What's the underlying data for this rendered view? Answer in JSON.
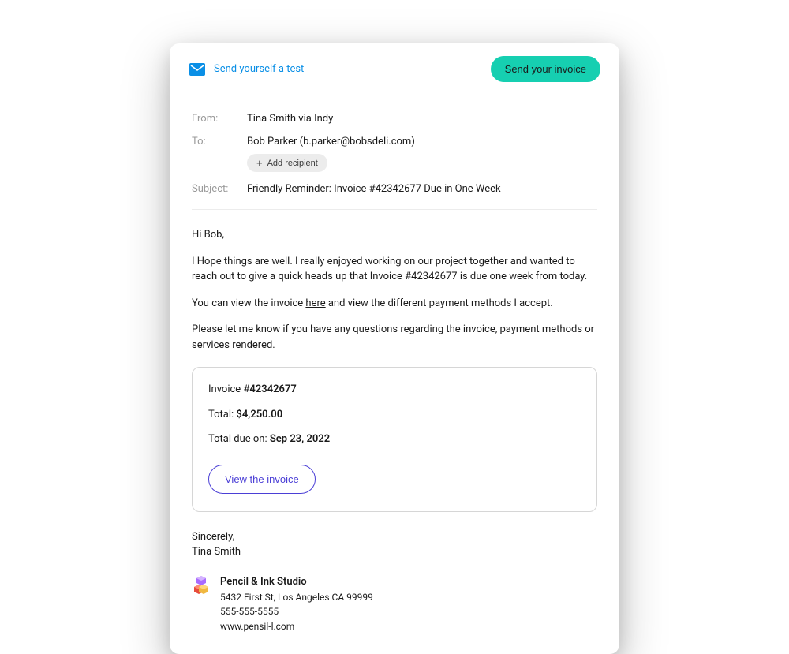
{
  "header": {
    "test_link": "Send yourself a test",
    "send_button": "Send your invoice"
  },
  "fields": {
    "from_label": "From:",
    "from_value": "Tina Smith via Indy",
    "to_label": "To:",
    "to_value": "Bob Parker (b.parker@bobsdeli.com)",
    "add_recipient": "Add recipient",
    "subject_label": "Subject:",
    "subject_value": "Friendly Reminder: Invoice #42342677 Due in One Week"
  },
  "body": {
    "greeting": "Hi Bob,",
    "para1": "I Hope things are well. I really enjoyed working on our project together and wanted to reach out to give a quick heads up that Invoice #42342677 is due one week from today.",
    "para2_before": "You can view the invoice ",
    "para2_link": "here",
    "para2_after": " and view the different payment methods I accept.",
    "para3": "Please let me know if you have any questions regarding the invoice, payment methods or services rendered."
  },
  "invoice": {
    "number_label": "Invoice #",
    "number": "42342677",
    "total_label": "Total: ",
    "total": "$4,250.00",
    "due_label": "Total due on: ",
    "due_date": "Sep 23, 2022",
    "view_button": "View the invoice"
  },
  "signoff": {
    "closing": "Sincerely,",
    "name": "Tina Smith"
  },
  "company": {
    "name": "Pencil & Ink Studio",
    "address": "5432 First St, Los Angeles CA 99999",
    "phone": "555-555-5555",
    "website": "www.pensil-l.com"
  }
}
